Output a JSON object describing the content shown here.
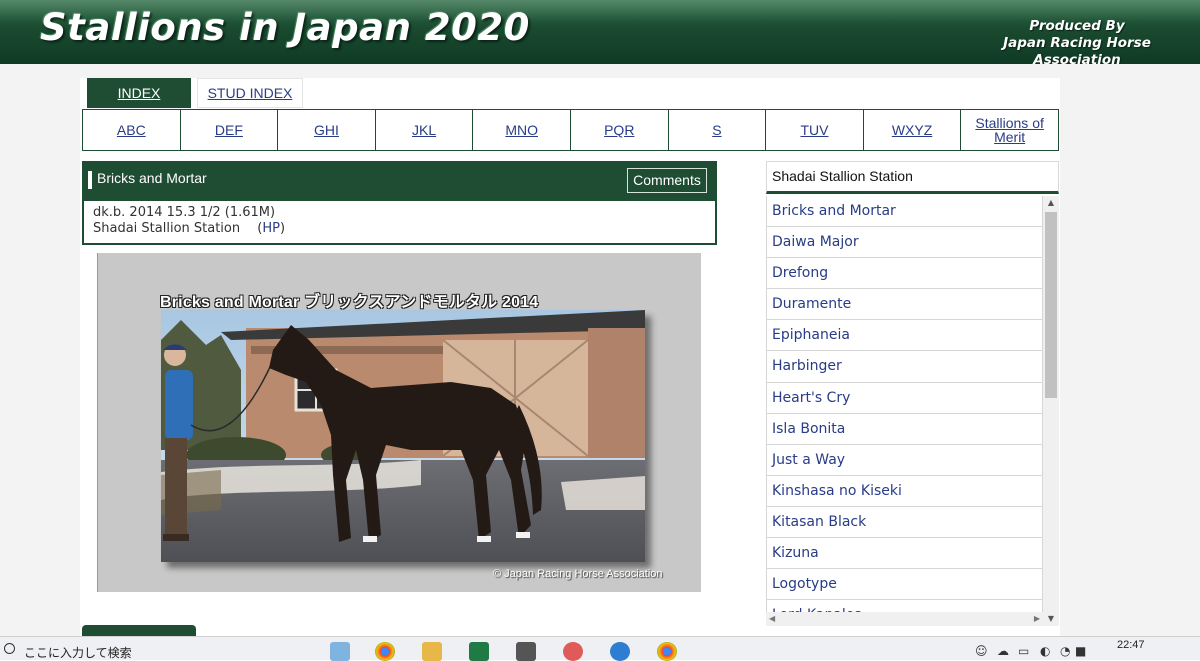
{
  "banner": {
    "title": "Stallions in Japan 2020",
    "produced_line1": "Produced By",
    "produced_line2": "Japan Racing Horse Association"
  },
  "tabs": {
    "index": "INDEX",
    "stud_index": "STUD INDEX"
  },
  "letters": [
    "ABC",
    "DEF",
    "GHI",
    "JKL",
    "MNO",
    "PQR",
    "S",
    "TUV",
    "WXYZ",
    "Stallions of Merit"
  ],
  "horse": {
    "name": "Bricks and Mortar",
    "comments_label": "Comments",
    "details": "dk.b. 2014 15.3 1/2 (1.61M)",
    "station": "Shadai Stallion Station",
    "hp_label": "HP"
  },
  "photo": {
    "title": "Bricks and Mortar ブリックスアンドモルタル 2014",
    "credit": "© Japan Racing Horse Association"
  },
  "station_panel": {
    "title": "Shadai Stallion Station",
    "horses": [
      "Bricks and Mortar",
      "Daiwa Major",
      "Drefong",
      "Duramente",
      "Epiphaneia",
      "Harbinger",
      "Heart's Cry",
      "Isla Bonita",
      "Just a Way",
      "Kinshasa no Kiseki",
      "Kitasan Black",
      "Kizuna",
      "Logotype",
      "Lord Kanaloa"
    ]
  },
  "taskbar": {
    "search_placeholder": "ここに入力して検索",
    "time": "22:47"
  },
  "colors": {
    "brand_green": "#1f4d33",
    "link_blue": "#283c87"
  }
}
